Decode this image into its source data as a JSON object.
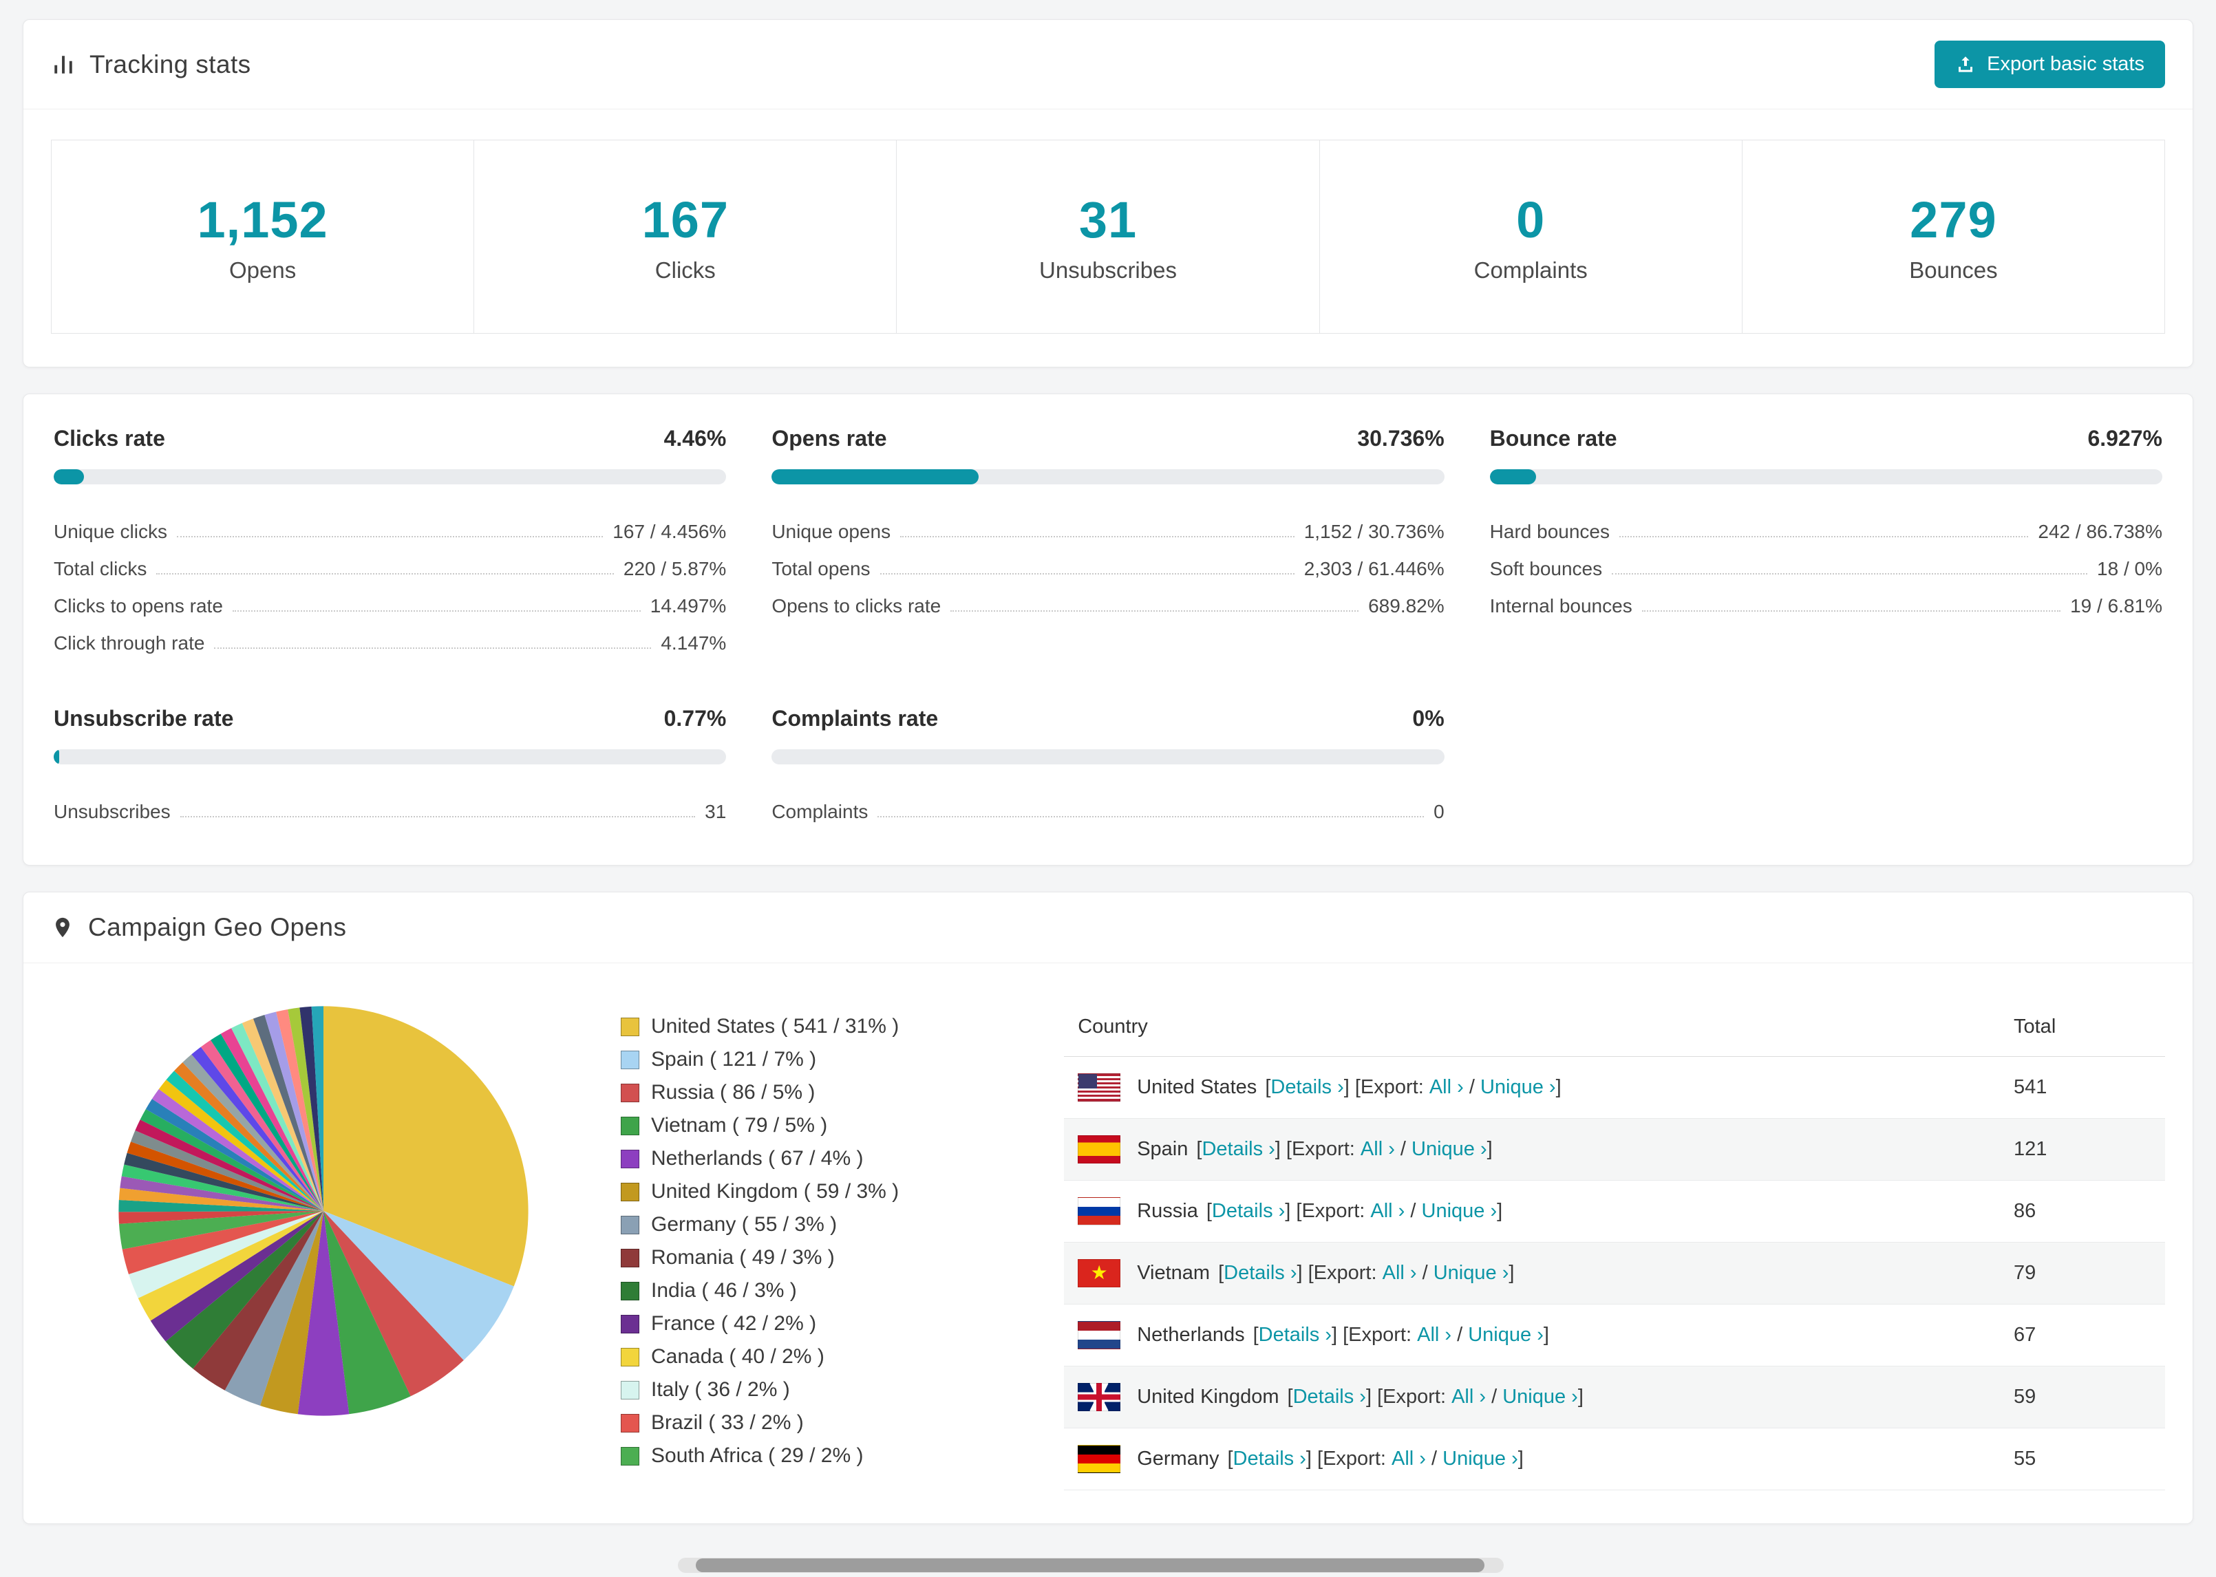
{
  "colors": {
    "accent": "#0c95a6"
  },
  "tracking": {
    "title": "Tracking stats",
    "export_button": "Export basic stats",
    "stats": [
      {
        "value": "1,152",
        "label": "Opens"
      },
      {
        "value": "167",
        "label": "Clicks"
      },
      {
        "value": "31",
        "label": "Unsubscribes"
      },
      {
        "value": "0",
        "label": "Complaints"
      },
      {
        "value": "279",
        "label": "Bounces"
      }
    ]
  },
  "rates": [
    {
      "title": "Clicks rate",
      "value": "4.46%",
      "percent": 4.46,
      "rows": [
        {
          "label": "Unique clicks",
          "value": "167 / 4.456%"
        },
        {
          "label": "Total clicks",
          "value": "220 / 5.87%"
        },
        {
          "label": "Clicks to opens rate",
          "value": "14.497%"
        },
        {
          "label": "Click through rate",
          "value": "4.147%"
        }
      ]
    },
    {
      "title": "Opens rate",
      "value": "30.736%",
      "percent": 30.736,
      "rows": [
        {
          "label": "Unique opens",
          "value": "1,152 / 30.736%"
        },
        {
          "label": "Total opens",
          "value": "2,303 / 61.446%"
        },
        {
          "label": "Opens to clicks rate",
          "value": "689.82%"
        }
      ]
    },
    {
      "title": "Bounce rate",
      "value": "6.927%",
      "percent": 6.927,
      "rows": [
        {
          "label": "Hard bounces",
          "value": "242 / 86.738%"
        },
        {
          "label": "Soft bounces",
          "value": "18 / 0%"
        },
        {
          "label": "Internal bounces",
          "value": "19 / 6.81%"
        }
      ]
    },
    {
      "title": "Unsubscribe rate",
      "value": "0.77%",
      "percent": 0.77,
      "rows": [
        {
          "label": "Unsubscribes",
          "value": "31"
        }
      ]
    },
    {
      "title": "Complaints rate",
      "value": "0%",
      "percent": 0,
      "rows": [
        {
          "label": "Complaints",
          "value": "0"
        }
      ]
    }
  ],
  "geo": {
    "title": "Campaign Geo Opens",
    "legend_format": "{label} ( {count} / {percent}% )",
    "table": {
      "headers": {
        "country": "Country",
        "total": "Total"
      },
      "labels": {
        "bracket_open": "[",
        "bracket_close": "]",
        "details": "Details",
        "export": "Export:",
        "all": "All",
        "unique": "Unique",
        "chevron": "›",
        "slash": "/"
      },
      "rows": [
        {
          "country": "United States",
          "flag": "us",
          "total": "541"
        },
        {
          "country": "Spain",
          "flag": "es",
          "total": "121"
        },
        {
          "country": "Russia",
          "flag": "ru",
          "total": "86"
        },
        {
          "country": "Vietnam",
          "flag": "vn",
          "total": "79"
        },
        {
          "country": "Netherlands",
          "flag": "nl",
          "total": "67"
        },
        {
          "country": "United Kingdom",
          "flag": "gb",
          "total": "59"
        },
        {
          "country": "Germany",
          "flag": "de",
          "total": "55"
        }
      ]
    }
  },
  "chart_data": {
    "type": "pie",
    "title": "Campaign Geo Opens",
    "unit": "opens",
    "legend_position": "right",
    "slices": [
      {
        "label": "United States",
        "count": 541,
        "percent": 31,
        "color": "#e8c33d"
      },
      {
        "label": "Spain",
        "count": 121,
        "percent": 7,
        "color": "#a8d4f2"
      },
      {
        "label": "Russia",
        "count": 86,
        "percent": 5,
        "color": "#d25050"
      },
      {
        "label": "Vietnam",
        "count": 79,
        "percent": 5,
        "color": "#3fa44a"
      },
      {
        "label": "Netherlands",
        "count": 67,
        "percent": 4,
        "color": "#8d3fc0"
      },
      {
        "label": "United Kingdom",
        "count": 59,
        "percent": 3,
        "color": "#c2991f"
      },
      {
        "label": "Germany",
        "count": 55,
        "percent": 3,
        "color": "#8aa0b4"
      },
      {
        "label": "Romania",
        "count": 49,
        "percent": 3,
        "color": "#8f3a3a"
      },
      {
        "label": "India",
        "count": 46,
        "percent": 3,
        "color": "#2f7d36"
      },
      {
        "label": "France",
        "count": 42,
        "percent": 2,
        "color": "#6b2f92"
      },
      {
        "label": "Canada",
        "count": 40,
        "percent": 2,
        "color": "#f2d53c"
      },
      {
        "label": "Italy",
        "count": 36,
        "percent": 2,
        "color": "#d7f4ef"
      },
      {
        "label": "Brazil",
        "count": 33,
        "percent": 2,
        "color": "#e4564f"
      },
      {
        "label": "South Africa",
        "count": 29,
        "percent": 2,
        "color": "#4cae52"
      }
    ],
    "unlabeled_small_slices": {
      "total_percent": 26,
      "approx_count": 28,
      "colors": [
        "#d64545",
        "#1aa287",
        "#f0a030",
        "#9b59b6",
        "#37c871",
        "#34495e",
        "#d35400",
        "#7f8c8d",
        "#c2185b",
        "#27ae60",
        "#2980b9",
        "#b868d8",
        "#f1c40f",
        "#16c7b0",
        "#e67e22",
        "#95a5a6",
        "#5e48e8",
        "#f06292",
        "#00a884",
        "#e84393",
        "#7de8c3",
        "#f7c873",
        "#5d6d7e",
        "#a59de8",
        "#ff8a80",
        "#a6c93a",
        "#30336b",
        "#26a6b8"
      ]
    }
  }
}
